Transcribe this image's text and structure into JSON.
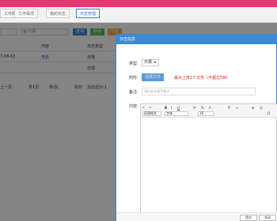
{
  "colors": {
    "brand": "#e8376f",
    "primary": "#3b8ad6",
    "warn": "#e02020"
  },
  "tabs": [
    {
      "label": "工作概览"
    },
    {
      "label": "工作事项"
    },
    {
      "label": "我的日志"
    },
    {
      "label": "日志管理"
    }
  ],
  "toolbar": {
    "search_placeholder": "",
    "date_label": "日期",
    "buttons": [
      "查询",
      "新增",
      "导出"
    ]
  },
  "table": {
    "headers": [
      "内容",
      "日志类型"
    ],
    "rows": [
      {
        "date": "7-08-02",
        "content": "查看",
        "type": "日报"
      },
      {
        "date": "",
        "content": "",
        "type": "日报"
      }
    ],
    "pager": {
      "first": "上一页",
      "total": "共1页",
      "per": "条/页",
      "jump": "跳转",
      "goto": "到第",
      "page": "页",
      "size_label": "当前显示:1"
    }
  },
  "dialog": {
    "title": "日志信息",
    "type_label": "类型:",
    "type_value": "日报",
    "attachment_label": "附件:",
    "upload_button": "选择文件",
    "upload_hint": "最大上传1个文件（不超过5M）",
    "remark_label": "备注:",
    "remark_placeholder": "请在此处填写备注",
    "content_label": "内容:",
    "editor": {
      "row1": [
        "↶",
        "↷",
        "B",
        "I",
        "U",
        "X²",
        "X₂",
        "A",
        "¶",
        "≡",
        "⊞",
        "☺",
        "Ω"
      ],
      "format_select": "段落格式",
      "font_select": "字体",
      "size_select": "16"
    },
    "submit_label": "提交",
    "close_label": "关闭"
  }
}
